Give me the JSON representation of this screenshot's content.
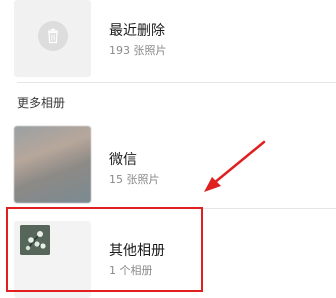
{
  "albums_top": {
    "recently_deleted": {
      "title": "最近删除",
      "count": "193 张照片",
      "icon": "trash-icon"
    }
  },
  "section": {
    "header": "更多相册"
  },
  "albums_more": [
    {
      "title": "微信",
      "count": "15 张照片"
    },
    {
      "title": "其他相册",
      "count": "1 个相册",
      "icon": "plant-icon"
    }
  ],
  "annotation": {
    "highlight_color": "#e02020",
    "arrow_color": "#e02020"
  }
}
